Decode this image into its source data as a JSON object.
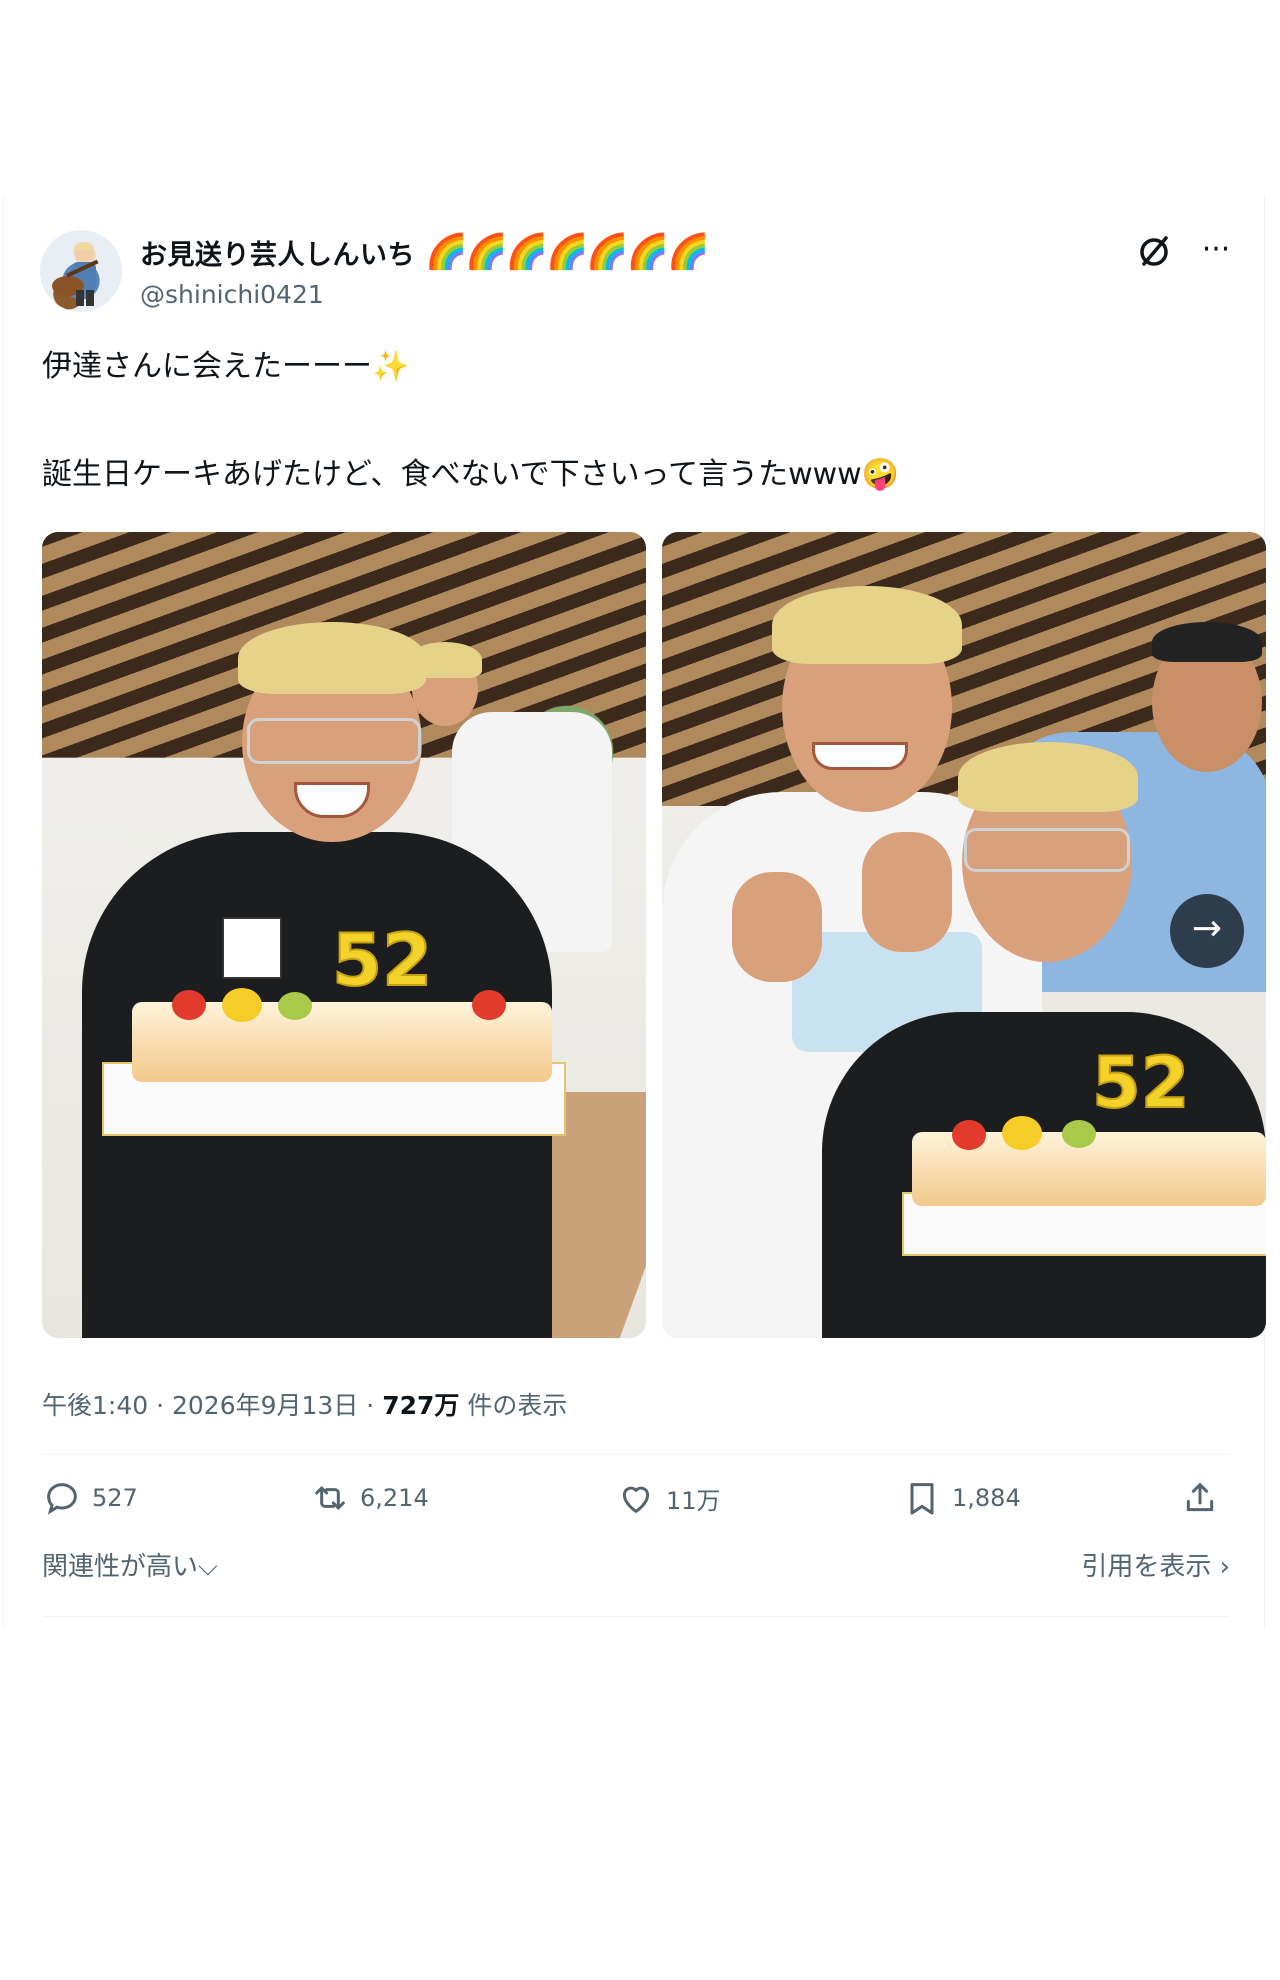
{
  "author": {
    "display_name": "お見送り芸人しんいち",
    "emoji": "🌈🌈🌈🌈🌈🌈🌈",
    "handle": "@shinichi0421"
  },
  "tweet": {
    "line1": "伊達さんに会えたーーー✨",
    "line2": "誕生日ケーキあげたけど、食べないで下さいって言うたwww🤪"
  },
  "photos": {
    "photo1_candles": "52",
    "photo2_candles": "52"
  },
  "meta": {
    "time": "午後1:40",
    "date": "2026年9月13日",
    "views_count": "727万",
    "views_label": "件の表示"
  },
  "actions": {
    "replies": "527",
    "reposts": "6,214",
    "likes": "11万",
    "bookmarks": "1,884"
  },
  "footer": {
    "sort": "関連性が高い⌵",
    "quotes": "引用を表示 ›"
  }
}
